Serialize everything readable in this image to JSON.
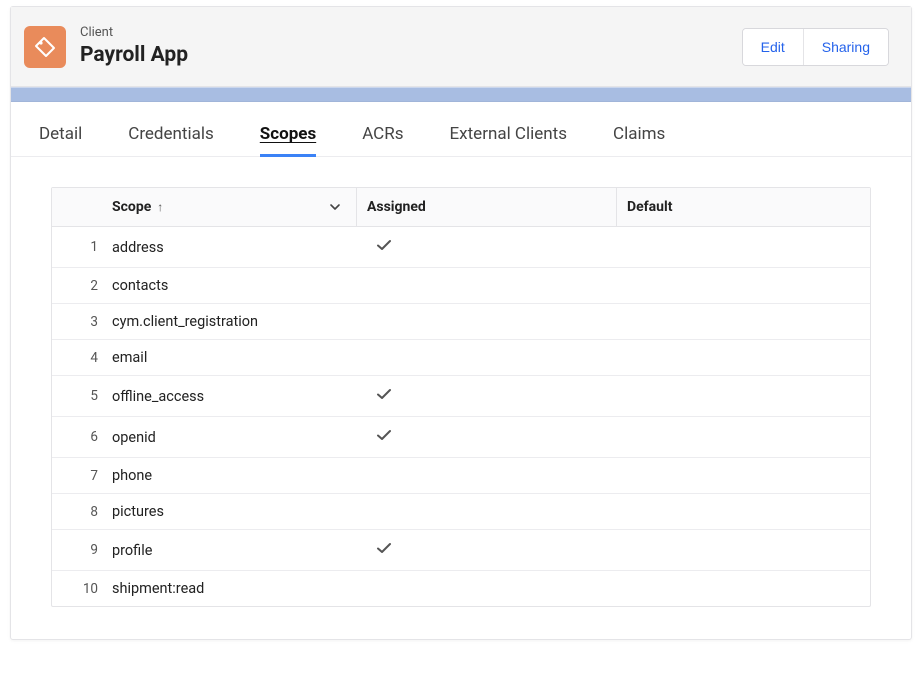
{
  "header": {
    "eyebrow": "Client",
    "title": "Payroll App",
    "actions": {
      "edit": "Edit",
      "sharing": "Sharing"
    }
  },
  "tabs": [
    {
      "key": "detail",
      "label": "Detail"
    },
    {
      "key": "credentials",
      "label": "Credentials"
    },
    {
      "key": "scopes",
      "label": "Scopes"
    },
    {
      "key": "acrs",
      "label": "ACRs"
    },
    {
      "key": "external-clients",
      "label": "External Clients"
    },
    {
      "key": "claims",
      "label": "Claims"
    }
  ],
  "active_tab": "scopes",
  "table": {
    "columns": {
      "scope": "Scope",
      "assigned": "Assigned",
      "default": "Default"
    },
    "sort_indicator": "↑",
    "rows": [
      {
        "n": "1",
        "scope": "address",
        "assigned": true,
        "default": false
      },
      {
        "n": "2",
        "scope": "contacts",
        "assigned": false,
        "default": false
      },
      {
        "n": "3",
        "scope": "cym.client_registration",
        "assigned": false,
        "default": false
      },
      {
        "n": "4",
        "scope": "email",
        "assigned": false,
        "default": false
      },
      {
        "n": "5",
        "scope": "offline_access",
        "assigned": true,
        "default": false
      },
      {
        "n": "6",
        "scope": "openid",
        "assigned": true,
        "default": false
      },
      {
        "n": "7",
        "scope": "phone",
        "assigned": false,
        "default": false
      },
      {
        "n": "8",
        "scope": "pictures",
        "assigned": false,
        "default": false
      },
      {
        "n": "9",
        "scope": "profile",
        "assigned": true,
        "default": false
      },
      {
        "n": "10",
        "scope": "shipment:read",
        "assigned": false,
        "default": false
      }
    ]
  }
}
